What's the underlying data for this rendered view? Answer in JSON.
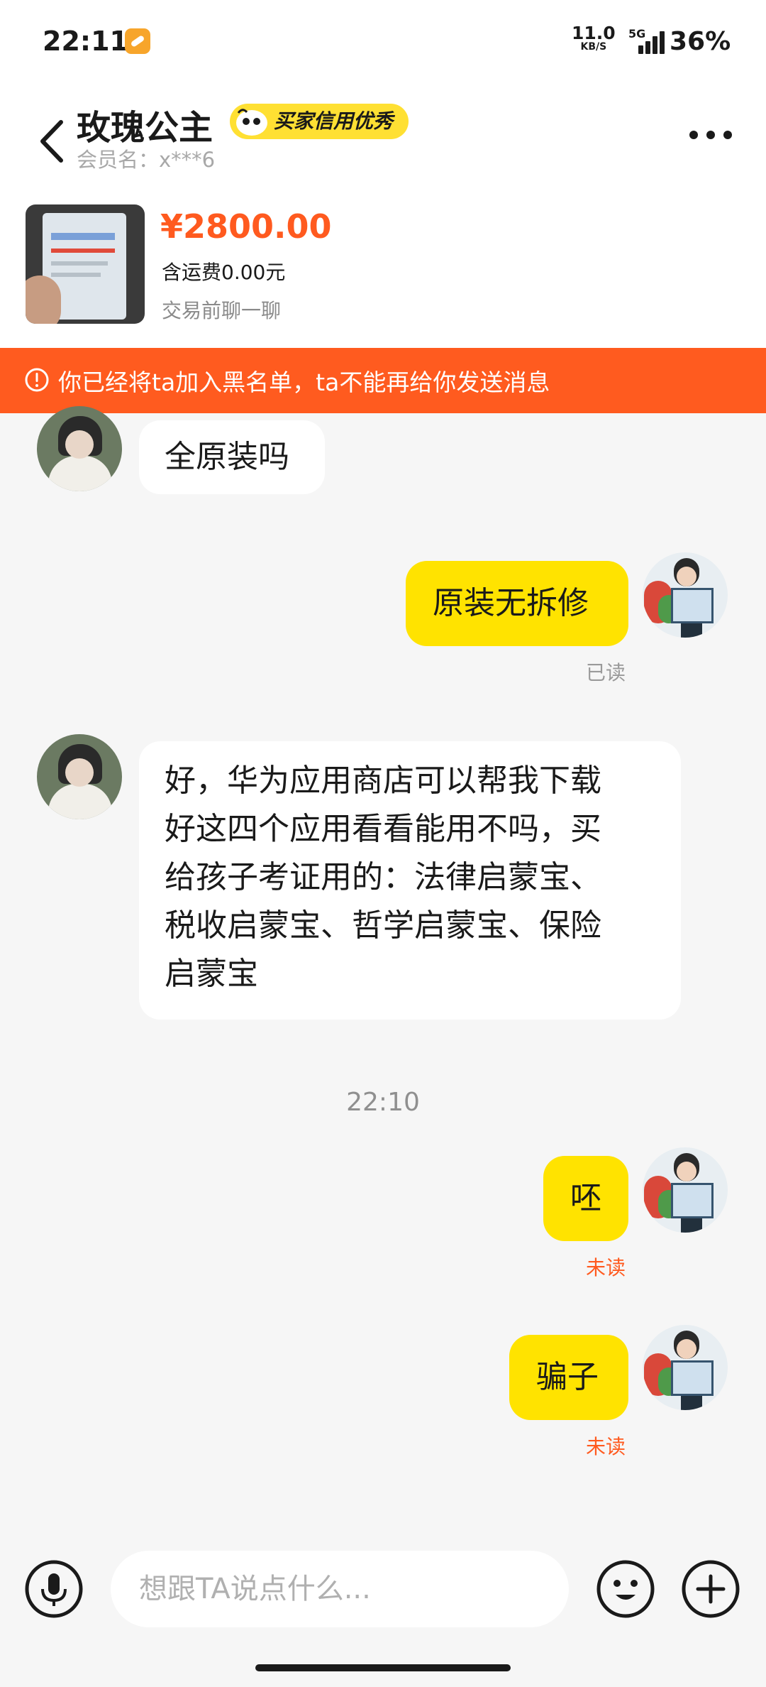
{
  "status_bar": {
    "time": "22:11",
    "net_speed": "11.0",
    "net_unit": "KB/S",
    "network": "5G",
    "battery": "36%",
    "app_icon": "xianyu-app-icon"
  },
  "header": {
    "contact_name": "玫瑰公主",
    "badge": "买家信用优秀",
    "member_name": "会员名：x***6",
    "back_icon": "chevron-left-icon",
    "more_icon": "more-dots-icon"
  },
  "product": {
    "price": "¥2800.00",
    "shipping": "含运费0.00元",
    "chat_hint": "交易前聊一聊"
  },
  "banner": {
    "text": "你已经将ta加入黑名单，ta不能再给你发送消息",
    "icon": "alert-circle-icon",
    "color": "#ff5b1f"
  },
  "messages": {
    "m1": {
      "from": "them",
      "text": "全原装吗"
    },
    "m2": {
      "from": "me",
      "text": "原装无拆修",
      "status": "已读"
    },
    "m3": {
      "from": "them",
      "lines": [
        "好，华为应用商店可以帮我下载",
        "好这四个应用看看能用不吗，买",
        "给孩子考证用的：法律启蒙宝、",
        "税收启蒙宝、哲学启蒙宝、保险",
        "启蒙宝"
      ]
    },
    "divider_time": "22:10",
    "m4": {
      "from": "me",
      "text": "呸",
      "status": "未读"
    },
    "m5": {
      "from": "me",
      "text": "骗子",
      "status": "未读"
    }
  },
  "input_bar": {
    "placeholder": "想跟TA说点什么...",
    "mic_icon": "microphone-icon",
    "emoji_icon": "emoji-smile-icon",
    "plus_icon": "plus-circle-icon"
  },
  "colors": {
    "accent_orange": "#ff5a1f",
    "bubble_yellow": "#ffe300",
    "badge_yellow": "#ffe033"
  }
}
